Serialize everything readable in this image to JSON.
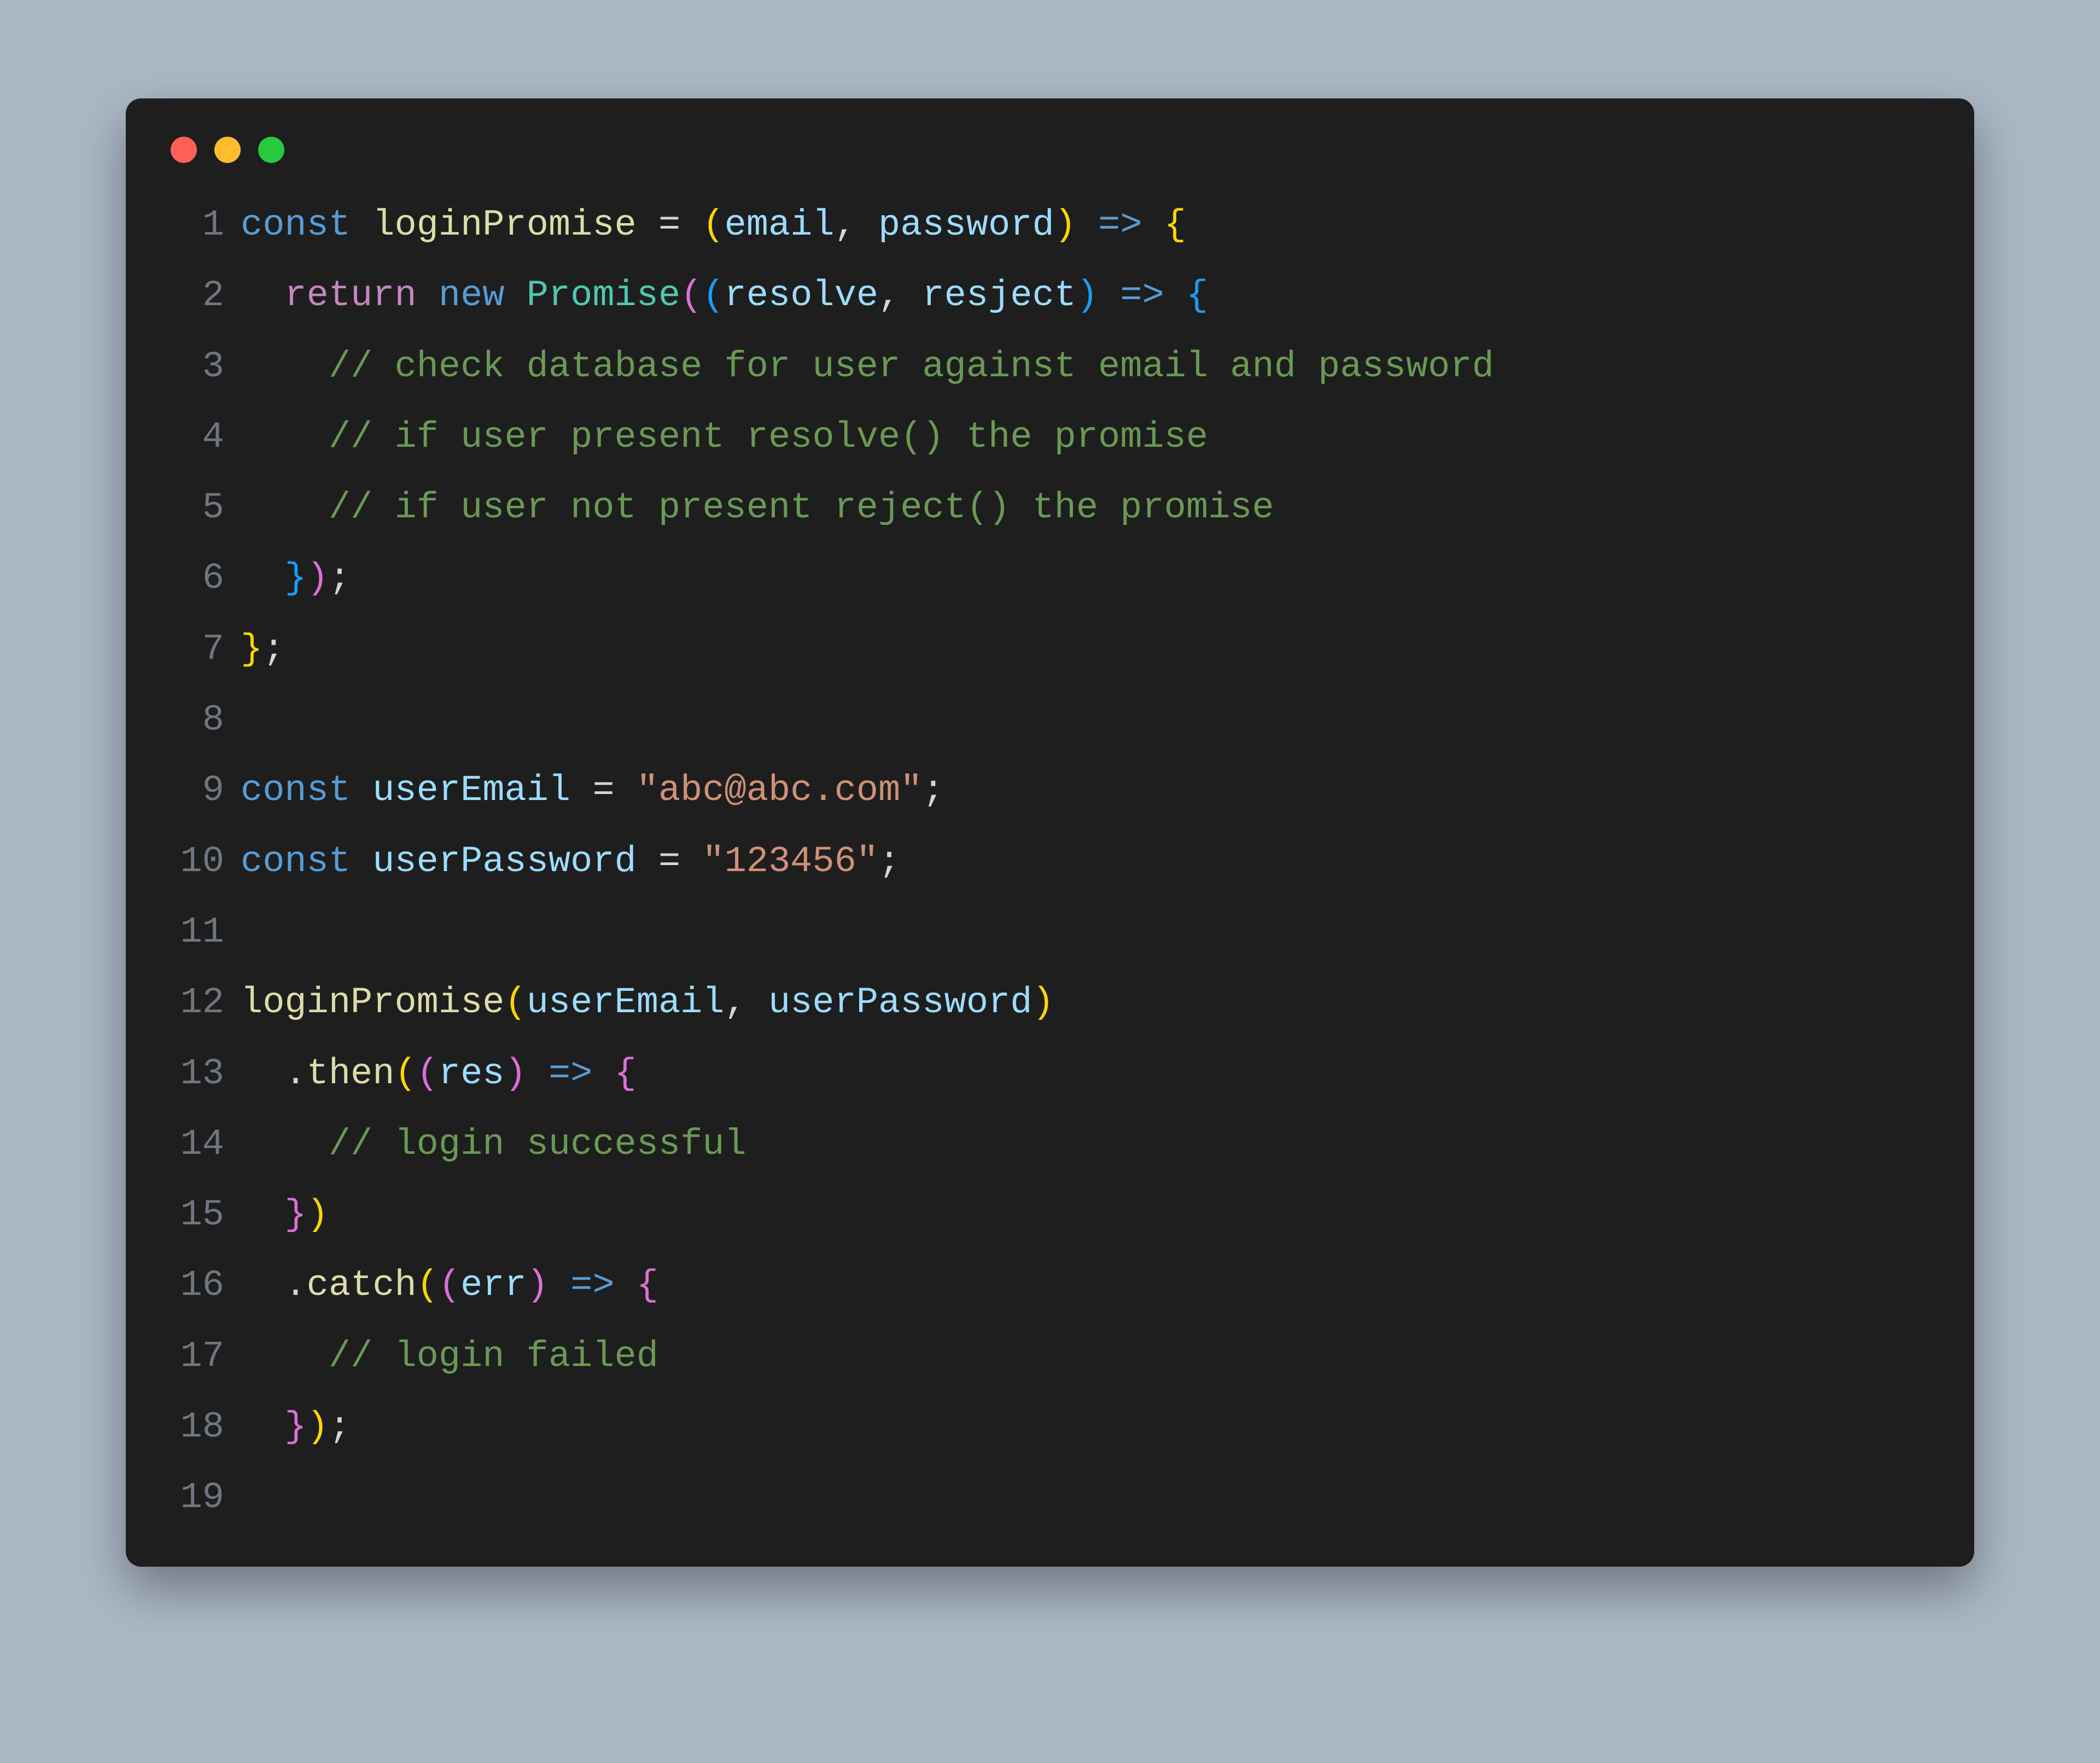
{
  "code": {
    "lines": [
      {
        "num": "1",
        "tokens": [
          {
            "t": "const ",
            "c": "storage"
          },
          {
            "t": "loginPromise",
            "c": "func"
          },
          {
            "t": " = ",
            "c": "default"
          },
          {
            "t": "(",
            "c": "p1"
          },
          {
            "t": "email",
            "c": "var"
          },
          {
            "t": ", ",
            "c": "default"
          },
          {
            "t": "password",
            "c": "var"
          },
          {
            "t": ")",
            "c": "p1"
          },
          {
            "t": " ",
            "c": "default"
          },
          {
            "t": "=>",
            "c": "storage"
          },
          {
            "t": " ",
            "c": "default"
          },
          {
            "t": "{",
            "c": "p1"
          }
        ]
      },
      {
        "num": "2",
        "tokens": [
          {
            "t": "  ",
            "c": "default"
          },
          {
            "t": "return ",
            "c": "keyword"
          },
          {
            "t": "new ",
            "c": "storage"
          },
          {
            "t": "Promise",
            "c": "class"
          },
          {
            "t": "(",
            "c": "p2"
          },
          {
            "t": "(",
            "c": "p3"
          },
          {
            "t": "resolve",
            "c": "var"
          },
          {
            "t": ", ",
            "c": "default"
          },
          {
            "t": "resject",
            "c": "var"
          },
          {
            "t": ")",
            "c": "p3"
          },
          {
            "t": " ",
            "c": "default"
          },
          {
            "t": "=>",
            "c": "storage"
          },
          {
            "t": " ",
            "c": "default"
          },
          {
            "t": "{",
            "c": "p3"
          }
        ]
      },
      {
        "num": "3",
        "tokens": [
          {
            "t": "    ",
            "c": "default"
          },
          {
            "t": "// check database for user against email and password",
            "c": "comment"
          }
        ]
      },
      {
        "num": "4",
        "tokens": [
          {
            "t": "    ",
            "c": "default"
          },
          {
            "t": "// if user present resolve() the promise",
            "c": "comment"
          }
        ]
      },
      {
        "num": "5",
        "tokens": [
          {
            "t": "    ",
            "c": "default"
          },
          {
            "t": "// if user not present reject() the promise",
            "c": "comment"
          }
        ]
      },
      {
        "num": "6",
        "tokens": [
          {
            "t": "  ",
            "c": "default"
          },
          {
            "t": "}",
            "c": "p3"
          },
          {
            "t": ")",
            "c": "p2"
          },
          {
            "t": ";",
            "c": "default"
          }
        ]
      },
      {
        "num": "7",
        "tokens": [
          {
            "t": "}",
            "c": "p1"
          },
          {
            "t": ";",
            "c": "default"
          }
        ]
      },
      {
        "num": "8",
        "tokens": []
      },
      {
        "num": "9",
        "tokens": [
          {
            "t": "const ",
            "c": "storage"
          },
          {
            "t": "userEmail",
            "c": "var"
          },
          {
            "t": " = ",
            "c": "default"
          },
          {
            "t": "\"abc@abc.com\"",
            "c": "string"
          },
          {
            "t": ";",
            "c": "default"
          }
        ]
      },
      {
        "num": "10",
        "tokens": [
          {
            "t": "const ",
            "c": "storage"
          },
          {
            "t": "userPassword",
            "c": "var"
          },
          {
            "t": " = ",
            "c": "default"
          },
          {
            "t": "\"123456\"",
            "c": "string"
          },
          {
            "t": ";",
            "c": "default"
          }
        ]
      },
      {
        "num": "11",
        "tokens": []
      },
      {
        "num": "12",
        "tokens": [
          {
            "t": "loginPromise",
            "c": "func"
          },
          {
            "t": "(",
            "c": "p1"
          },
          {
            "t": "userEmail",
            "c": "var"
          },
          {
            "t": ", ",
            "c": "default"
          },
          {
            "t": "userPassword",
            "c": "var"
          },
          {
            "t": ")",
            "c": "p1"
          }
        ]
      },
      {
        "num": "13",
        "tokens": [
          {
            "t": "  .",
            "c": "default"
          },
          {
            "t": "then",
            "c": "func"
          },
          {
            "t": "(",
            "c": "p1"
          },
          {
            "t": "(",
            "c": "p2"
          },
          {
            "t": "res",
            "c": "var"
          },
          {
            "t": ")",
            "c": "p2"
          },
          {
            "t": " ",
            "c": "default"
          },
          {
            "t": "=>",
            "c": "storage"
          },
          {
            "t": " ",
            "c": "default"
          },
          {
            "t": "{",
            "c": "p2"
          }
        ]
      },
      {
        "num": "14",
        "tokens": [
          {
            "t": "    ",
            "c": "default"
          },
          {
            "t": "// login successful",
            "c": "comment"
          }
        ]
      },
      {
        "num": "15",
        "tokens": [
          {
            "t": "  ",
            "c": "default"
          },
          {
            "t": "}",
            "c": "p2"
          },
          {
            "t": ")",
            "c": "p1"
          }
        ]
      },
      {
        "num": "16",
        "tokens": [
          {
            "t": "  .",
            "c": "default"
          },
          {
            "t": "catch",
            "c": "func"
          },
          {
            "t": "(",
            "c": "p1"
          },
          {
            "t": "(",
            "c": "p2"
          },
          {
            "t": "err",
            "c": "var"
          },
          {
            "t": ")",
            "c": "p2"
          },
          {
            "t": " ",
            "c": "default"
          },
          {
            "t": "=>",
            "c": "storage"
          },
          {
            "t": " ",
            "c": "default"
          },
          {
            "t": "{",
            "c": "p2"
          }
        ]
      },
      {
        "num": "17",
        "tokens": [
          {
            "t": "    ",
            "c": "default"
          },
          {
            "t": "// login failed",
            "c": "comment"
          }
        ]
      },
      {
        "num": "18",
        "tokens": [
          {
            "t": "  ",
            "c": "default"
          },
          {
            "t": "}",
            "c": "p2"
          },
          {
            "t": ")",
            "c": "p1"
          },
          {
            "t": ";",
            "c": "default"
          }
        ]
      },
      {
        "num": "19",
        "tokens": []
      }
    ]
  }
}
